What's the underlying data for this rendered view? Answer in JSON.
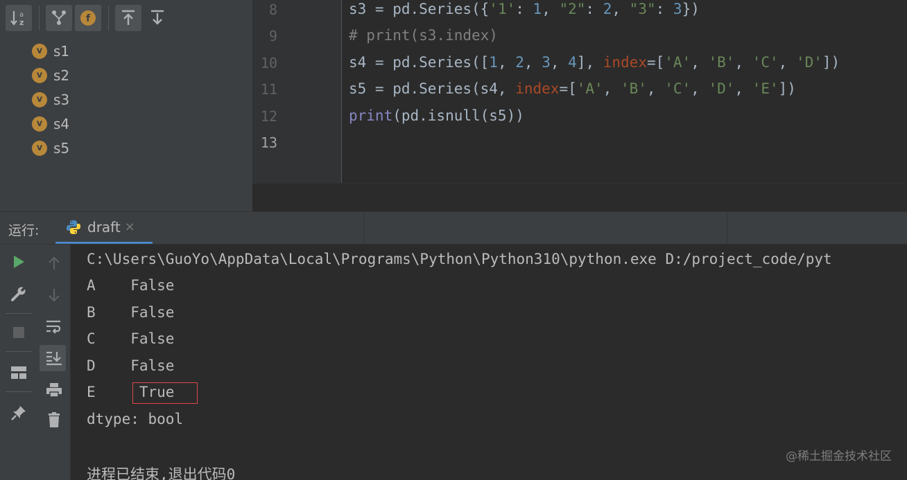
{
  "structure": {
    "items": [
      {
        "badge": "v",
        "label": "s1"
      },
      {
        "badge": "v",
        "label": "s2"
      },
      {
        "badge": "v",
        "label": "s3"
      },
      {
        "badge": "v",
        "label": "s4"
      },
      {
        "badge": "v",
        "label": "s5"
      }
    ]
  },
  "editor": {
    "line_numbers": [
      "8",
      "9",
      "10",
      "11",
      "12",
      "13"
    ],
    "current_line": "13"
  },
  "run": {
    "label": "运行:",
    "tab_label": "draft",
    "tab_close": "×"
  },
  "console": {
    "lines": [
      "C:\\Users\\GuoYo\\AppData\\Local\\Programs\\Python\\Python310\\python.exe D:/project_code/pyt",
      "A    False",
      "B    False",
      "C    False",
      "D    False",
      "E     True",
      "dtype: bool",
      "",
      "进程已结束,退出代码0"
    ]
  },
  "watermark": "@稀土掘金技术社区",
  "colors": {
    "accent_tab": "#4a88c7",
    "run_green": "#59a869",
    "badge_orange": "#b8883a",
    "highlight_box": "#e04848"
  }
}
